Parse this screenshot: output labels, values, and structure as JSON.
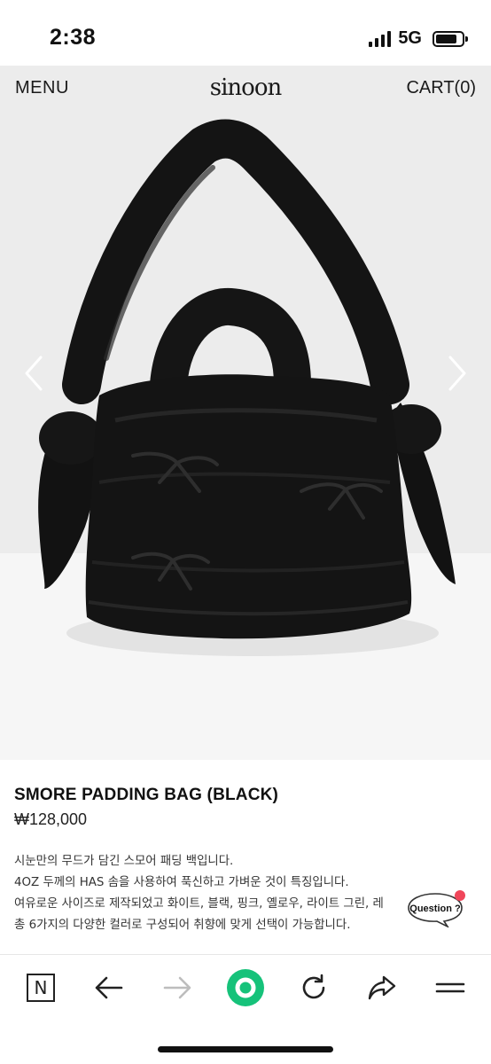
{
  "status_bar": {
    "time": "2:38",
    "network": "5G"
  },
  "nav": {
    "menu_label": "MENU",
    "brand": "sinoon",
    "cart_label": "CART(0)"
  },
  "product": {
    "name": "SMORE PADDING BAG (BLACK)",
    "price": "₩128,000",
    "description_lines": [
      "시눈만의 무드가 담긴 스모어 패딩 백입니다.",
      "4OZ 두께의 HAS 솜을 사용하여 푹신하고 가벼운 것이 특징입니다.",
      "여유로운 사이즈로 제작되었고 화이트, 블랙, 핑크, 옐로우, 라이트 그린, 레",
      "총 6가지의 다양한 컬러로 구성되어 취향에 맞게 선택이 가능합니다."
    ]
  },
  "question_bubble": {
    "label": "Question ?"
  },
  "toolbar": {
    "home_letter": "N"
  },
  "colors": {
    "accent_green": "#16c27a",
    "notification_red": "#f0465a",
    "bag": "#141414"
  },
  "icons": [
    "naver-n-icon",
    "back-arrow-icon",
    "forward-arrow-icon",
    "green-dot-icon",
    "reload-icon",
    "share-icon",
    "hamburger-menu-icon"
  ]
}
